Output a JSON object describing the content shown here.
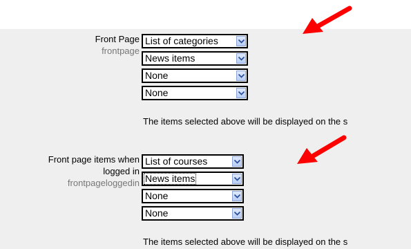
{
  "setting1": {
    "title": "Front Page",
    "key": "frontpage",
    "selects": [
      "List of categories",
      "News items",
      "None",
      "None"
    ],
    "description": "The items selected above will be displayed on the s"
  },
  "setting2": {
    "title_line1": "Front page items when",
    "title_line2": "logged in",
    "key": "frontpageloggedin",
    "selects": [
      "List of courses",
      "News items",
      "None",
      "None"
    ],
    "description": "The items selected above will be displayed on the s"
  },
  "arrow_color": "#ff0000"
}
